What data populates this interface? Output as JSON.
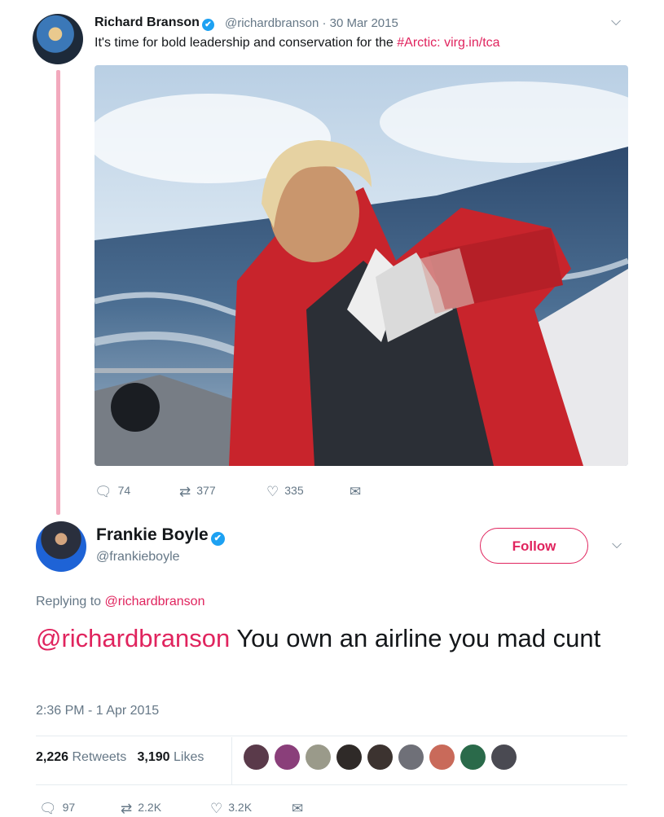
{
  "original_tweet": {
    "name": "Richard Branson",
    "verified_mark": "✔",
    "handle_date": "@richardbranson · 30 Mar 2015",
    "text_prefix": "It's time for bold leadership and conservation for the ",
    "hashtag": "#Arctic",
    "text_link": ": virg.in/tca",
    "menu_icon": "chevron-down-icon",
    "actions": {
      "replies": "74",
      "retweets": "377",
      "likes": "335"
    }
  },
  "reply_tweet": {
    "name": "Frankie Boyle",
    "verified_mark": "✔",
    "handle": "@frankieboyle",
    "follow_label": "Follow",
    "replying_label": "Replying to ",
    "replying_to": "@richardbranson",
    "mention": "@richardbranson",
    "text": " You own an airline you mad cunt",
    "timestamp": "2:36 PM - 1 Apr 2015",
    "retweets_count": "2,226",
    "retweets_label": " Retweets",
    "likes_count": "3,190",
    "likes_label": " Likes",
    "actions": {
      "replies": "97",
      "retweets": "2.2K",
      "likes": "3.2K"
    }
  },
  "colors": {
    "accent": "#e0245e",
    "muted": "#657786",
    "verified": "#1da1f2",
    "thread_line": "#f2a9bd"
  }
}
